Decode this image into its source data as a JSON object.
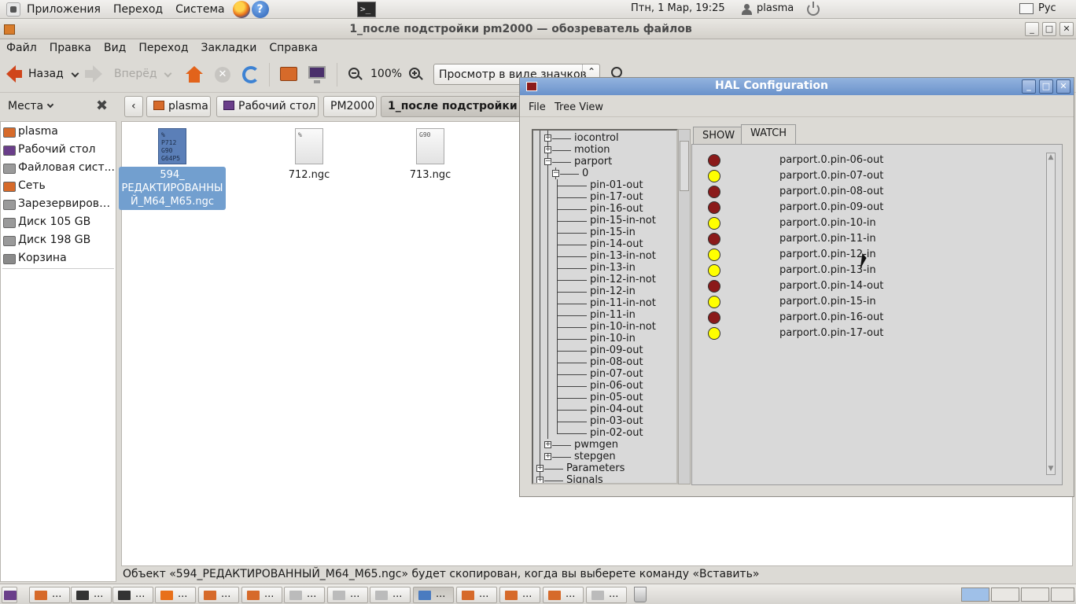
{
  "top_panel": {
    "menus": [
      "Приложения",
      "Переход",
      "Система"
    ],
    "clock": "Птн,  1 Мар, 19:25",
    "user": "plasma",
    "lang": "Рус"
  },
  "file_manager": {
    "title": "1_после подстройки pm2000 — обозреватель файлов",
    "menu": [
      "Файл",
      "Правка",
      "Вид",
      "Переход",
      "Закладки",
      "Справка"
    ],
    "toolbar": {
      "back": "Назад",
      "forward": "Вперёд",
      "zoom": "100%",
      "view_mode": "Просмотр в виде значков"
    },
    "places_label": "Места",
    "path": [
      "plasma",
      "Рабочий стол",
      "PM2000",
      "1_после подстройки р"
    ],
    "places": [
      {
        "label": "plasma",
        "color": "#d66a2a"
      },
      {
        "label": "Рабочий стол",
        "color": "#6a3e8a"
      },
      {
        "label": "Файловая сист...",
        "color": "#9a9a9a"
      },
      {
        "label": "Сеть",
        "color": "#d66a2a"
      },
      {
        "label": "Зарезервирова...",
        "color": "#9a9a9a"
      },
      {
        "label": "Диск 105 GB",
        "color": "#9a9a9a"
      },
      {
        "label": "Диск 198 GB",
        "color": "#9a9a9a"
      },
      {
        "label": "Корзина",
        "color": "#8a8a8a"
      }
    ],
    "files": [
      {
        "name_lines": [
          "594_",
          "РЕДАКТИРОВАННЫ",
          "Й_M64_M65.ngc"
        ],
        "preview": [
          "%",
          "P712",
          "G90",
          "G64P5"
        ],
        "selected": true
      },
      {
        "name_lines": [
          "712.ngc"
        ],
        "preview": [
          "%"
        ],
        "selected": false
      },
      {
        "name_lines": [
          "713.ngc"
        ],
        "preview": [
          "G90"
        ],
        "selected": false
      }
    ],
    "status": "Объект «594_РЕДАКТИРОВАННЫЙ_M64_M65.ngc» будет скопирован, когда вы выберете команду «Вставить»"
  },
  "hal": {
    "title": "HAL Configuration",
    "menu": [
      "File",
      "Tree View"
    ],
    "tree": {
      "top": [
        "iocontrol",
        "motion",
        "parport"
      ],
      "parport_child": "0",
      "pins": [
        "pin-01-out",
        "pin-17-out",
        "pin-16-out",
        "pin-15-in-not",
        "pin-15-in",
        "pin-14-out",
        "pin-13-in-not",
        "pin-13-in",
        "pin-12-in-not",
        "pin-12-in",
        "pin-11-in-not",
        "pin-11-in",
        "pin-10-in-not",
        "pin-10-in",
        "pin-09-out",
        "pin-08-out",
        "pin-07-out",
        "pin-06-out",
        "pin-05-out",
        "pin-04-out",
        "pin-03-out",
        "pin-02-out"
      ],
      "after": [
        "pwmgen",
        "stepgen"
      ],
      "root_after": [
        "Parameters",
        "Signals"
      ]
    },
    "tabs": [
      "SHOW",
      "WATCH"
    ],
    "watch": [
      {
        "name": "parport.0.pin-06-out",
        "state": "off"
      },
      {
        "name": "parport.0.pin-07-out",
        "state": "on"
      },
      {
        "name": "parport.0.pin-08-out",
        "state": "off"
      },
      {
        "name": "parport.0.pin-09-out",
        "state": "off"
      },
      {
        "name": "parport.0.pin-10-in",
        "state": "on"
      },
      {
        "name": "parport.0.pin-11-in",
        "state": "off"
      },
      {
        "name": "parport.0.pin-12-in",
        "state": "on"
      },
      {
        "name": "parport.0.pin-13-in",
        "state": "on"
      },
      {
        "name": "parport.0.pin-14-out",
        "state": "off"
      },
      {
        "name": "parport.0.pin-15-in",
        "state": "on"
      },
      {
        "name": "parport.0.pin-16-out",
        "state": "off"
      },
      {
        "name": "parport.0.pin-17-out",
        "state": "on"
      }
    ],
    "colors": {
      "on": "#ffff00",
      "off": "#8b1a1a"
    }
  },
  "taskbar": {
    "label": "...",
    "items": [
      {
        "icon": "#d66a2a"
      },
      {
        "icon": "#333333"
      },
      {
        "icon": "#333333"
      },
      {
        "icon": "#e8701a"
      },
      {
        "icon": "#d66a2a"
      },
      {
        "icon": "#d66a2a"
      },
      {
        "icon": "#bbbbbb"
      },
      {
        "icon": "#bbbbbb"
      },
      {
        "icon": "#bbbbbb"
      },
      {
        "icon": "#4a7bc0"
      },
      {
        "icon": "#d66a2a"
      },
      {
        "icon": "#d66a2a"
      },
      {
        "icon": "#d66a2a"
      },
      {
        "icon": "#bbbbbb"
      }
    ]
  }
}
